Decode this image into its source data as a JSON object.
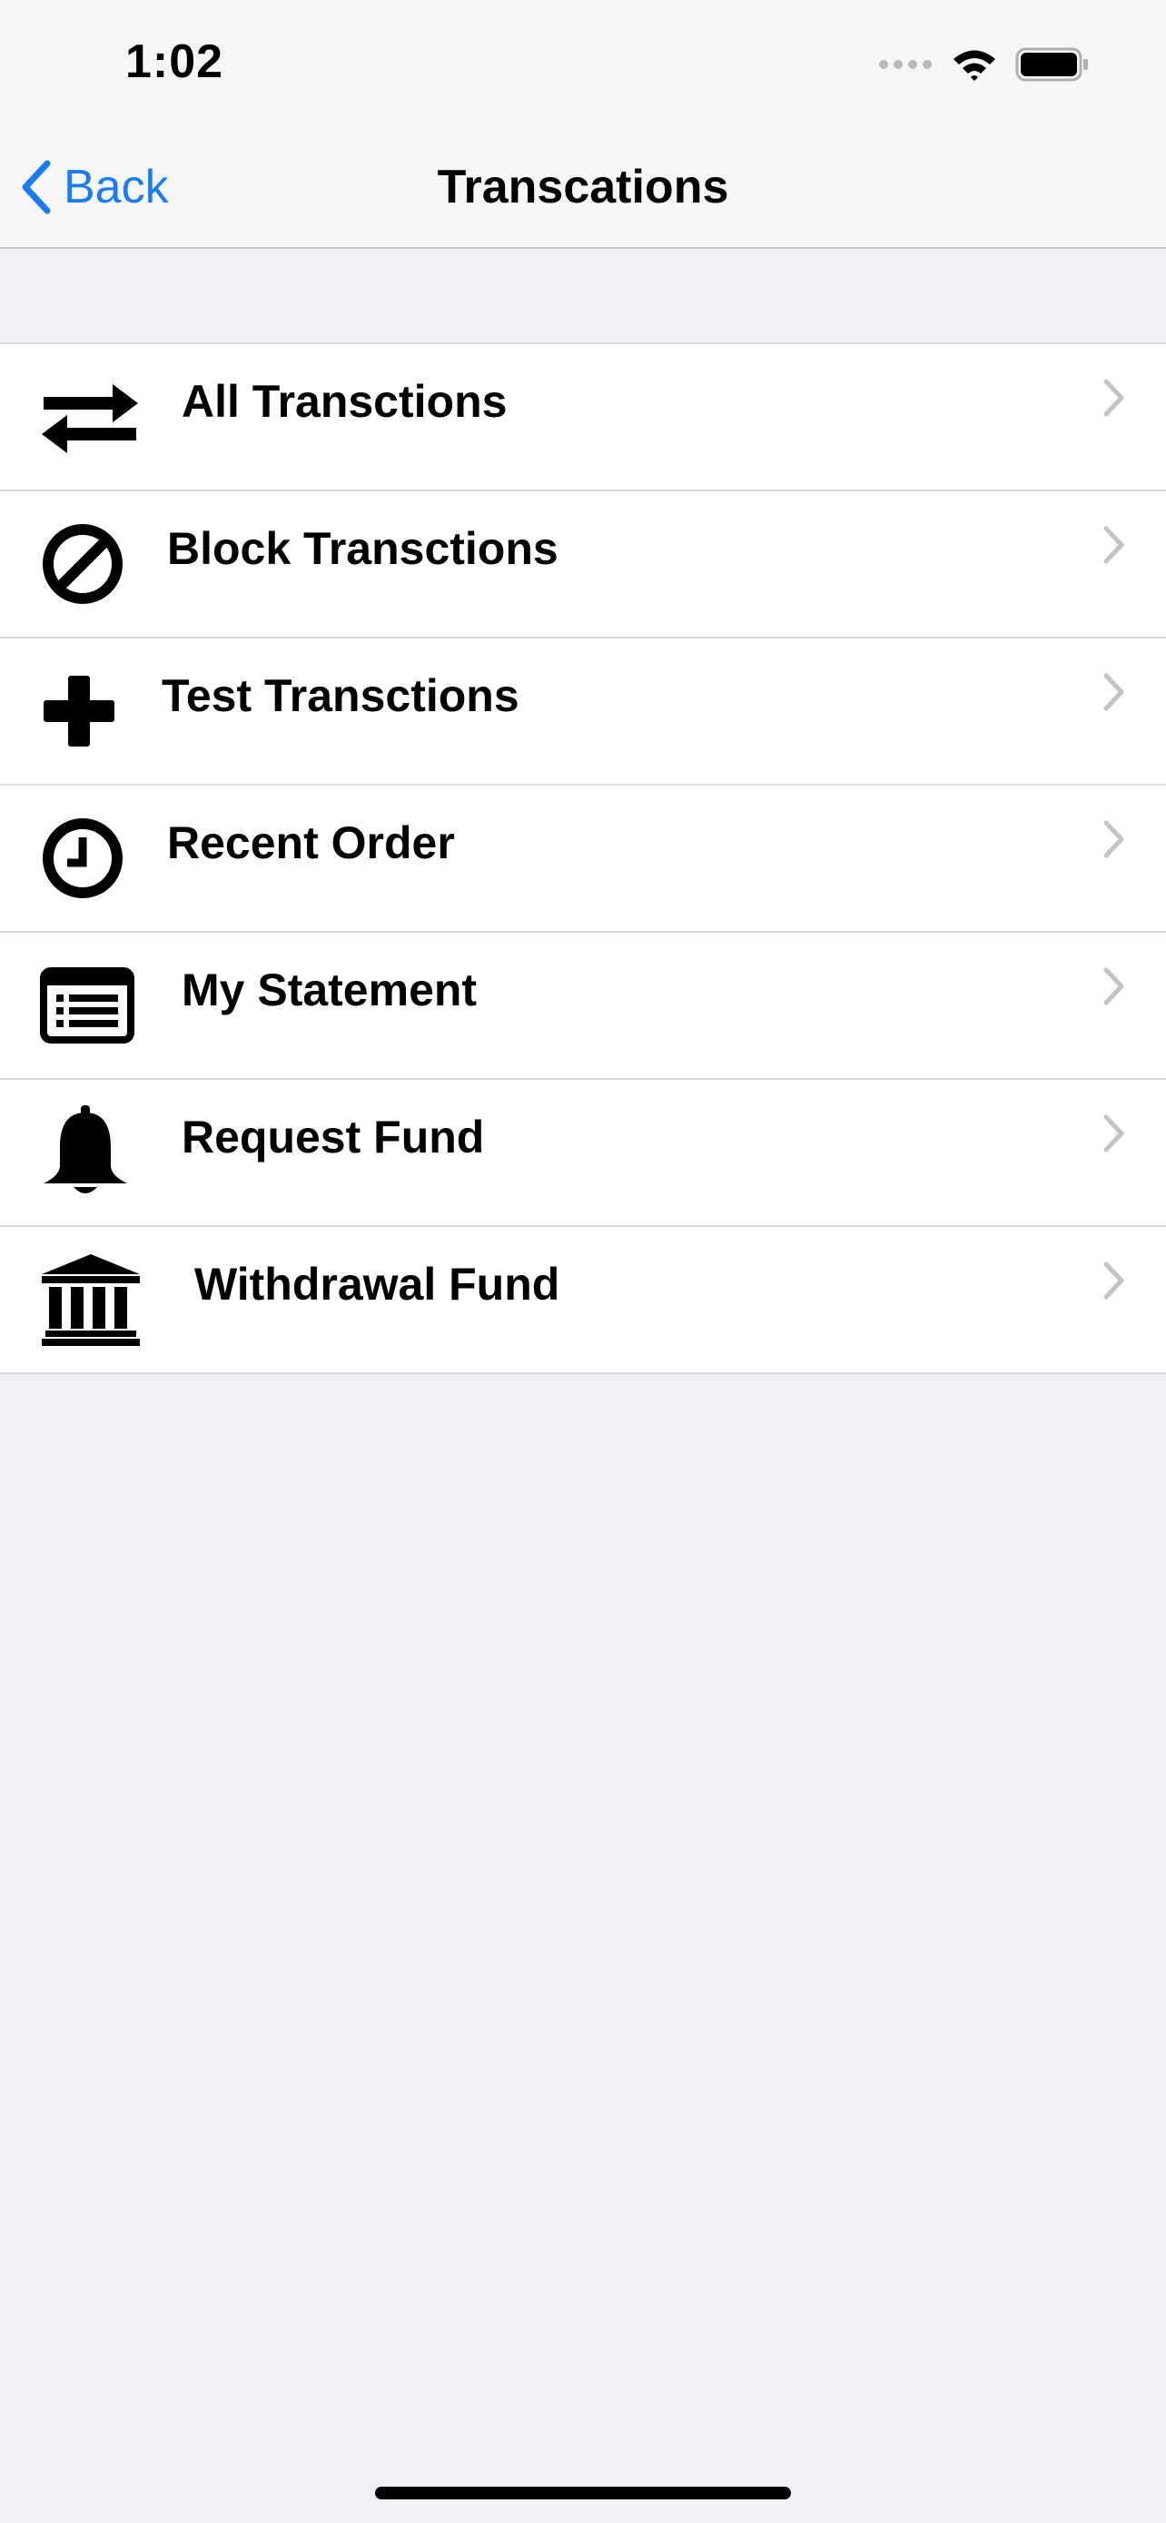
{
  "status_bar": {
    "time": "1:02",
    "icons": [
      "cellular-signal-icon",
      "wifi-icon",
      "battery-icon"
    ]
  },
  "nav": {
    "back_label": "Back",
    "title": "Transcations"
  },
  "colors": {
    "accent": "#1a7cf5",
    "background": "#efeff4",
    "separator": "#d9d9de",
    "chevron": "#c4c4c7"
  },
  "menu": {
    "items": [
      {
        "label": "All Transctions",
        "icon": "swap-arrows-icon"
      },
      {
        "label": "Block Transctions",
        "icon": "ban-icon"
      },
      {
        "label": "Test Transctions",
        "icon": "plus-icon"
      },
      {
        "label": "Recent Order",
        "icon": "clock-icon"
      },
      {
        "label": "My Statement",
        "icon": "list-icon"
      },
      {
        "label": "Request Fund",
        "icon": "bell-icon"
      },
      {
        "label": "Withdrawal Fund",
        "icon": "bank-icon"
      }
    ]
  }
}
